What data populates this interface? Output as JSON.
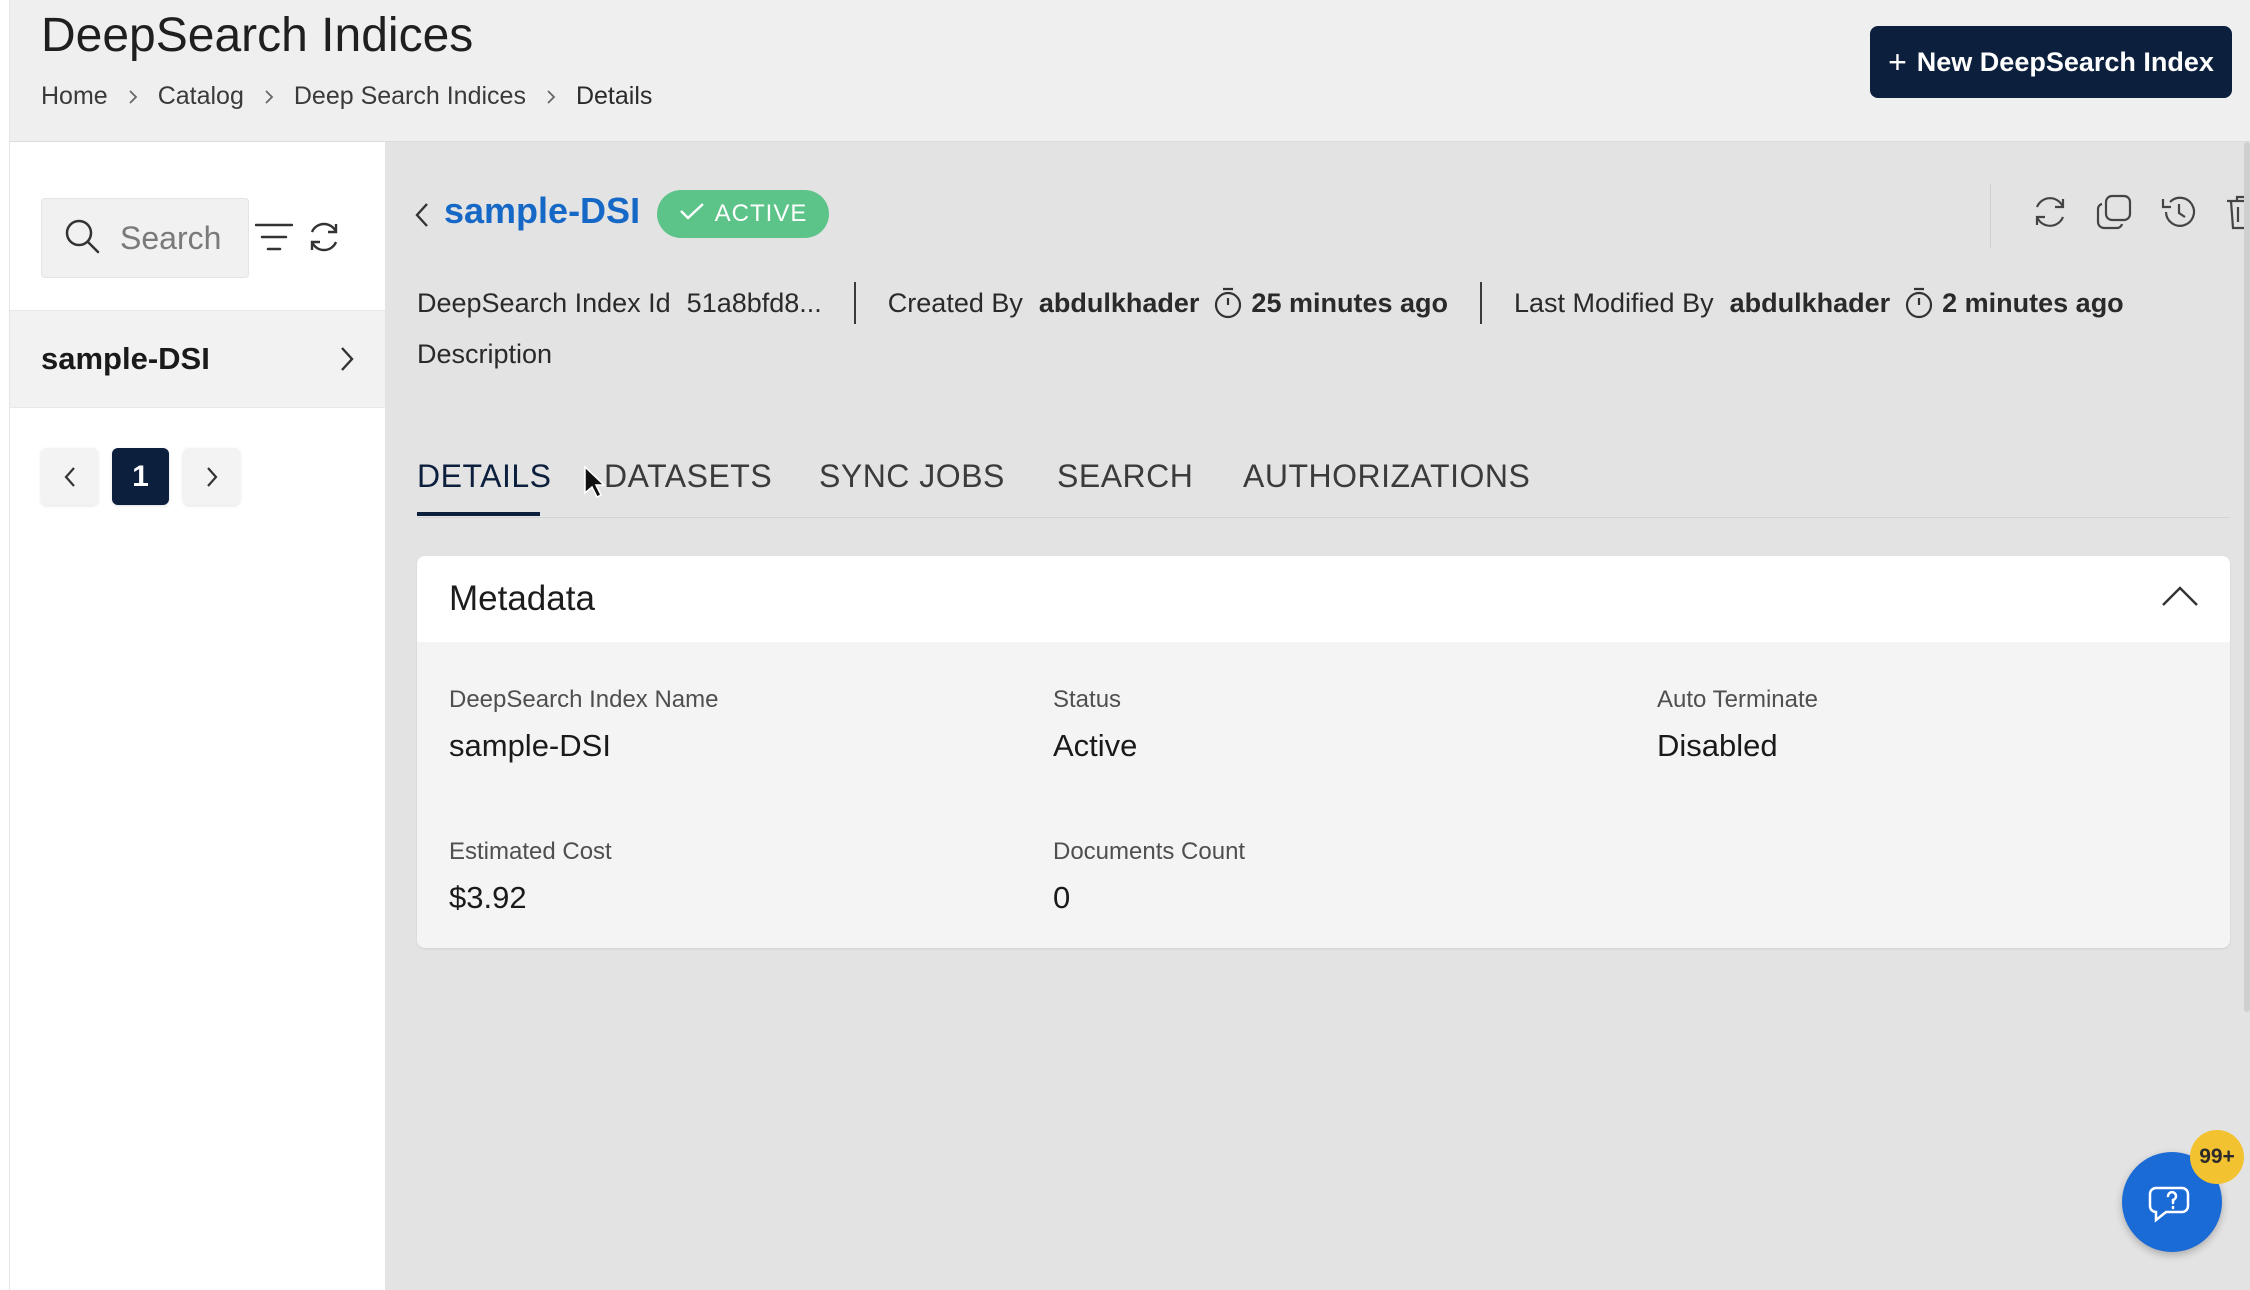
{
  "header": {
    "title": "DeepSearch Indices",
    "breadcrumb": [
      "Home",
      "Catalog",
      "Deep Search Indices",
      "Details"
    ],
    "new_button_label": "New DeepSearch Index"
  },
  "sidebar": {
    "search_placeholder": "Search",
    "items": [
      {
        "label": "sample-DSI"
      }
    ],
    "pagination": {
      "current_page": "1"
    }
  },
  "detail": {
    "name": "sample-DSI",
    "status_badge": "ACTIVE",
    "id_label": "DeepSearch Index Id",
    "id_value": "51a8bfd8...",
    "created_by_label": "Created By",
    "created_by_user": "abdulkhader",
    "created_time": "25 minutes ago",
    "modified_by_label": "Last Modified By",
    "modified_by_user": "abdulkhader",
    "modified_time": "2 minutes ago",
    "description_label": "Description"
  },
  "tabs": [
    {
      "label": "DETAILS",
      "active": true
    },
    {
      "label": "DATASETS"
    },
    {
      "label": "SYNC JOBS"
    },
    {
      "label": "SEARCH"
    },
    {
      "label": "AUTHORIZATIONS"
    }
  ],
  "metadata": {
    "title": "Metadata",
    "fields": [
      {
        "label": "DeepSearch Index Name",
        "value": "sample-DSI"
      },
      {
        "label": "Status",
        "value": "Active"
      },
      {
        "label": "Auto Terminate",
        "value": "Disabled"
      },
      {
        "label": "Estimated Cost",
        "value": "$3.92"
      },
      {
        "label": "Documents Count",
        "value": "0"
      }
    ]
  },
  "help": {
    "badge": "99+"
  },
  "colors": {
    "primary": "#0c1f3d",
    "link": "#1668c6",
    "active_green": "#5dc489",
    "fab": "#1a6bd6",
    "badge": "#f2c230"
  }
}
